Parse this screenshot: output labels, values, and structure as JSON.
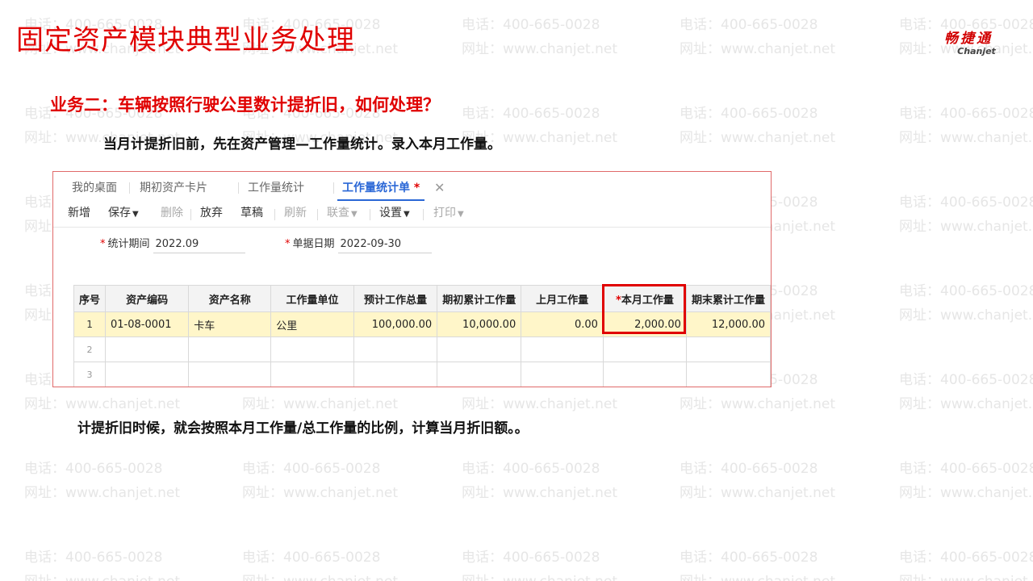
{
  "slide": {
    "title": "固定资产模块典型业务处理",
    "subtitle": "业务二：车辆按照行驶公里数计提折旧，如何处理？",
    "note1": "当月计提折旧前，先在资产管理—工作量统计。录入本月工作量。",
    "note2": "计提折旧时候，就会按照本月工作量/总工作量的比例，计算当月折旧额。。"
  },
  "logo": {
    "cn": "畅捷通",
    "en": "Chanjet",
    "color": "#d10000"
  },
  "watermark": {
    "line1": "电话：400-665-0028",
    "line2": "网址：www.chanjet.net"
  },
  "tabs": [
    {
      "label": "我的桌面"
    },
    {
      "label": "期初资产卡片"
    },
    {
      "label": "工作量统计"
    },
    {
      "label": "工作量统计单",
      "modified_mark": "*"
    }
  ],
  "toolbar": {
    "new": "新增",
    "save": "保存",
    "delete": "删除",
    "discard": "放弃",
    "draft": "草稿",
    "refresh": "刷新",
    "link_query": "联查",
    "settings": "设置",
    "print": "打印"
  },
  "form": {
    "period": {
      "label": "统计期间",
      "value": "2022.09"
    },
    "doc_date": {
      "label": "单据日期",
      "value": "2022-09-30"
    }
  },
  "grid": {
    "columns": [
      "序号",
      "资产编码",
      "资产名称",
      "工作量单位",
      "预计工作总量",
      "期初累计工作量",
      "上月工作量",
      "本月工作量",
      "期末累计工作量"
    ],
    "rows": [
      {
        "idx": "1",
        "code": "01-08-0001",
        "name": "卡车",
        "unit": "公里",
        "total": "100,000.00",
        "opening": "10,000.00",
        "last_month": "0.00",
        "this_month": "2,000.00",
        "closing": "12,000.00"
      },
      {
        "idx": "2",
        "code": "",
        "name": "",
        "unit": "",
        "total": "",
        "opening": "",
        "last_month": "",
        "this_month": "",
        "closing": ""
      },
      {
        "idx": "3",
        "code": "",
        "name": "",
        "unit": "",
        "total": "",
        "opening": "",
        "last_month": "",
        "this_month": "",
        "closing": ""
      }
    ]
  },
  "colors": {
    "accent_red": "#e00000",
    "active_tab_blue": "#2a67d6",
    "selected_row": "#fff6c9"
  }
}
